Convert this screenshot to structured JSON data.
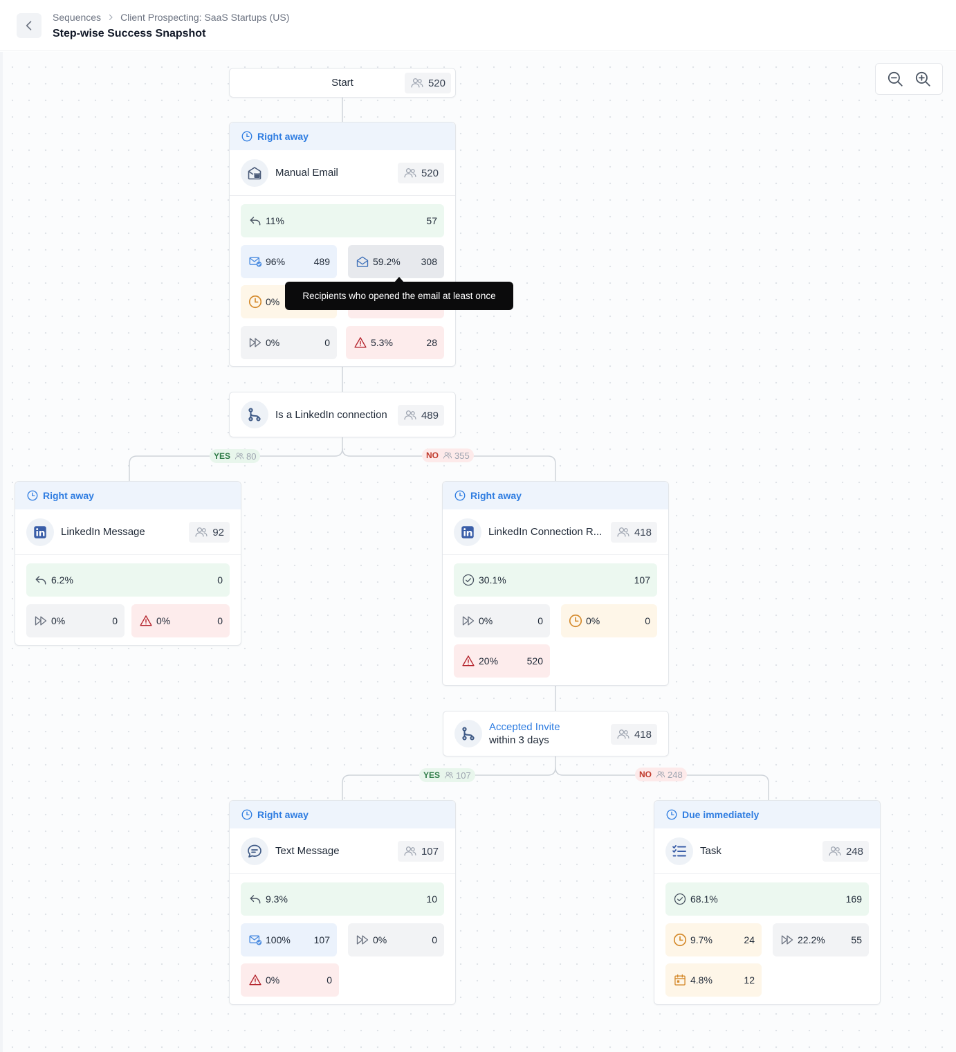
{
  "header": {
    "breadcrumb": [
      "Sequences",
      "Client Prospecting: SaaS Startups (US)"
    ],
    "title": "Step-wise Success Snapshot"
  },
  "icons": {
    "back": "chevron-left-icon",
    "breadcrumb_separator": "chevron-right-icon",
    "zoom_out": "zoom-out-icon",
    "zoom_in": "zoom-in-icon",
    "users": "users-icon",
    "clock": "clock-icon",
    "reply": "reply-icon",
    "delivered": "mail-check-icon",
    "opened": "mail-open-icon",
    "skipped": "skip-forward-icon",
    "error": "alert-triangle-icon",
    "check": "check-circle-icon",
    "calendar": "calendar-icon",
    "branch": "branch-icon"
  },
  "colors": {
    "accent": "#2f7de1",
    "reply": "#ecf8f0",
    "delivered": "#ebf2fc",
    "pending": "#fef6e8",
    "error": "#fdecec",
    "skipped": "#f2f3f5"
  },
  "tooltip": "Recipients who opened the email at least once",
  "start": {
    "label": "Start",
    "count": "520"
  },
  "manual_email": {
    "timing": "Right away",
    "name": "Manual Email",
    "count": "520",
    "replied": {
      "pct": "11%",
      "val": "57"
    },
    "delivered": {
      "pct": "96%",
      "val": "489"
    },
    "opened": {
      "pct": "59.2%",
      "val": "308"
    },
    "pending": {
      "pct": "0%"
    },
    "skipped": {
      "pct": "0%",
      "val": "0"
    },
    "error": {
      "pct": "5.3%",
      "val": "28"
    }
  },
  "cond1": {
    "label": "Is a LinkedIn connection",
    "count": "489",
    "yes": {
      "label": "YES",
      "count": "80"
    },
    "no": {
      "label": "NO",
      "count": "355"
    }
  },
  "linkedin_message": {
    "timing": "Right away",
    "name": "LinkedIn Message",
    "count": "92",
    "replied": {
      "pct": "6.2%",
      "val": "0"
    },
    "skipped": {
      "pct": "0%",
      "val": "0"
    },
    "error": {
      "pct": "0%",
      "val": "0"
    }
  },
  "linkedin_connection": {
    "timing": "Right away",
    "name": "LinkedIn Connection R...",
    "count": "418",
    "accepted": {
      "pct": "30.1%",
      "val": "107"
    },
    "skipped": {
      "pct": "0%",
      "val": "0"
    },
    "pending": {
      "pct": "0%",
      "val": "0"
    },
    "error": {
      "pct": "20%",
      "val": "520"
    }
  },
  "cond2": {
    "label_line1": "Accepted Invite",
    "label_line2": "within 3 days",
    "count": "418",
    "yes": {
      "label": "YES",
      "count": "107"
    },
    "no": {
      "label": "NO",
      "count": "248"
    }
  },
  "text_message": {
    "timing": "Right away",
    "name": "Text Message",
    "count": "107",
    "replied": {
      "pct": "9.3%",
      "val": "10"
    },
    "delivered": {
      "pct": "100%",
      "val": "107"
    },
    "skipped": {
      "pct": "0%",
      "val": "0"
    },
    "error": {
      "pct": "0%",
      "val": "0"
    }
  },
  "task": {
    "timing": "Due immediately",
    "name": "Task",
    "count": "248",
    "completed": {
      "pct": "68.1%",
      "val": "169"
    },
    "pending": {
      "pct": "9.7%",
      "val": "24"
    },
    "skipped": {
      "pct": "22.2%",
      "val": "55"
    },
    "due": {
      "pct": "4.8%",
      "val": "12"
    }
  }
}
